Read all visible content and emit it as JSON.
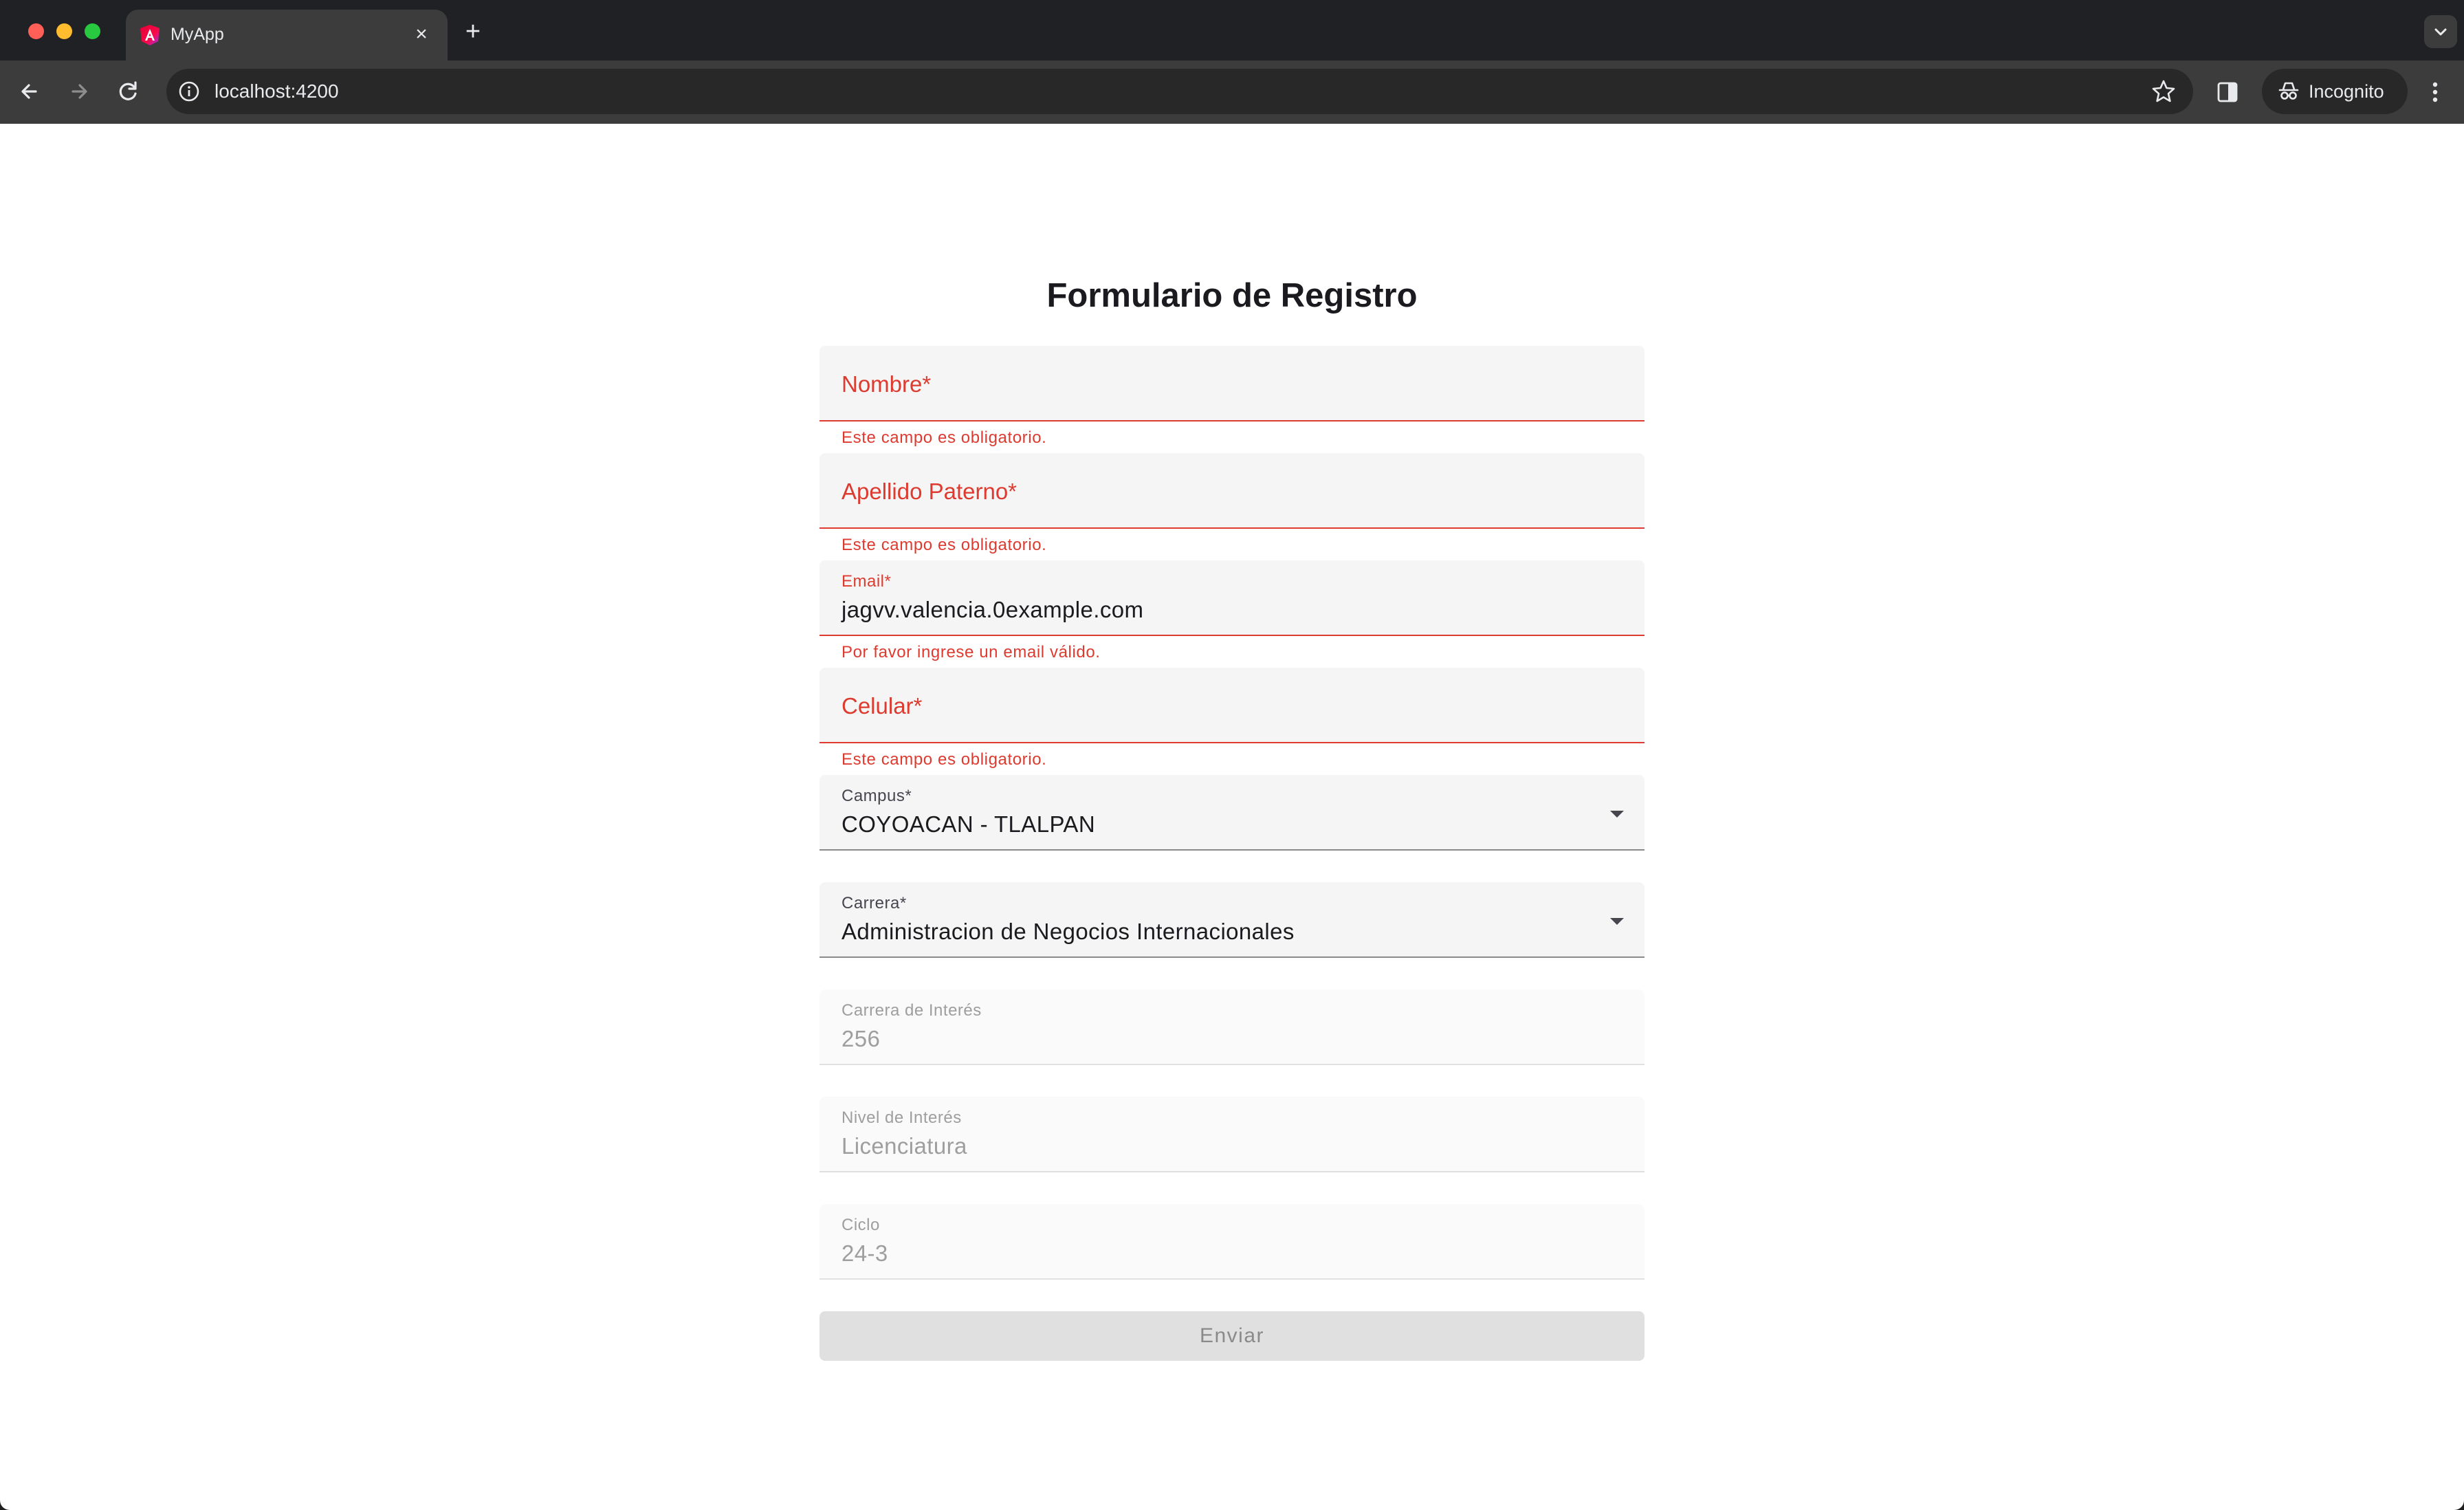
{
  "browser": {
    "tab_title": "MyApp",
    "url": "localhost:4200",
    "profile_label": "Incognito"
  },
  "form": {
    "title": "Formulario de Registro",
    "fields": {
      "nombre": {
        "label": "Nombre*",
        "value": "",
        "error": "Este campo es obligatorio."
      },
      "apellido": {
        "label": "Apellido Paterno*",
        "value": "",
        "error": "Este campo es obligatorio."
      },
      "email": {
        "label": "Email*",
        "value": "jagvv.valencia.0example.com",
        "error": "Por favor ingrese un email válido."
      },
      "celular": {
        "label": "Celular*",
        "value": "",
        "error": "Este campo es obligatorio."
      },
      "campus": {
        "label": "Campus*",
        "value": "COYOACAN - TLALPAN"
      },
      "carrera": {
        "label": "Carrera*",
        "value": "Administracion de Negocios Internacionales"
      },
      "carrera_interes": {
        "label": "Carrera de Interés",
        "value": "256"
      },
      "nivel_interes": {
        "label": "Nivel de Interés",
        "value": "Licenciatura"
      },
      "ciclo": {
        "label": "Ciclo",
        "value": "24-3"
      }
    },
    "submit_label": "Enviar"
  },
  "colors": {
    "error": "#dd3b30",
    "field_bg": "#f5f5f5",
    "chrome_bg": "#3c3c3c"
  }
}
